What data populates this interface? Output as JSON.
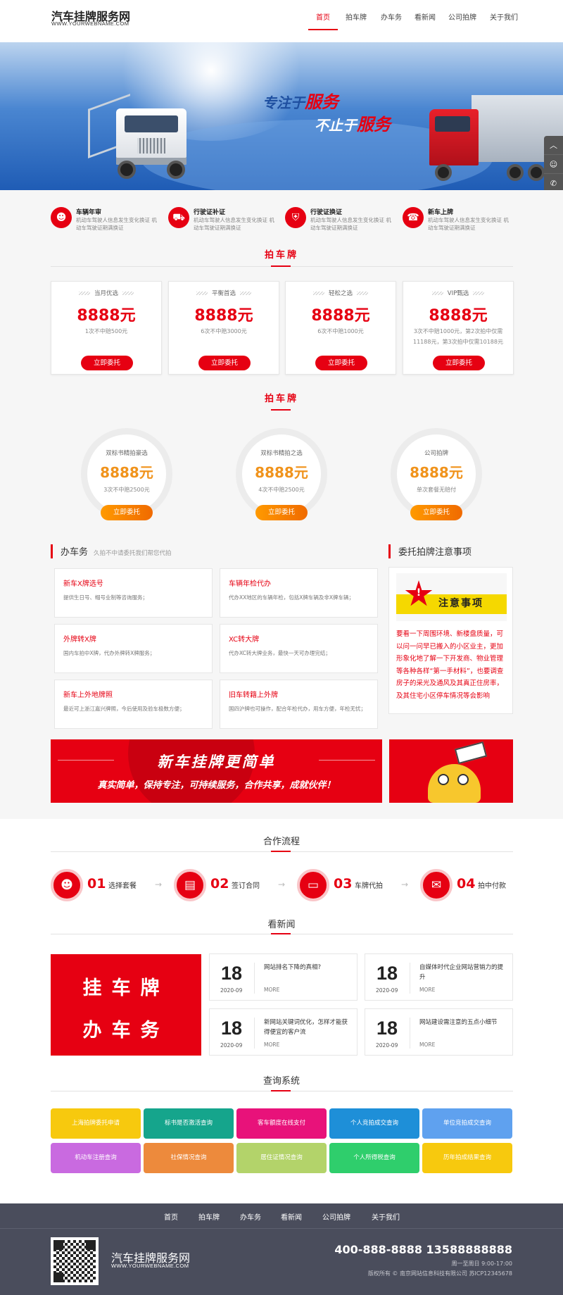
{
  "header": {
    "logo_title": "汽车挂牌服务网",
    "logo_sub": "WWW.YOURWEBNAME.COM",
    "nav": [
      "首页",
      "拍车牌",
      "办车务",
      "看新闻",
      "公司拍牌",
      "关于我们"
    ],
    "active_nav": "首页"
  },
  "banner": {
    "line1_prefix": "专注于",
    "line1_highlight": "服务",
    "line2_prefix": "不止于",
    "line2_highlight": "服务",
    "slide_count": 3,
    "active_slide": 3
  },
  "services": [
    {
      "title": "车辆年审",
      "desc": "机动车驾驶人信息发生变化换证 机动车驾驶证期满换证"
    },
    {
      "title": "行驶证补证",
      "desc": "机动车驾驶人信息发生变化换证 机动车驾驶证期满换证"
    },
    {
      "title": "行驶证换证",
      "desc": "机动车驾驶人信息发生变化换证 机动车驾驶证期满换证"
    },
    {
      "title": "新车上牌",
      "desc": "机动车驾驶人信息发生变化换证 机动车驾驶证期满换证"
    }
  ],
  "plates_title": "拍车牌",
  "plans": [
    {
      "label": "当月优选",
      "price": "8888元",
      "desc": "1次不中赔500元",
      "button": "立即委托"
    },
    {
      "label": "平衡首选",
      "price": "8888元",
      "desc": "6次不中赔3000元",
      "button": "立即委托"
    },
    {
      "label": "轻松之选",
      "price": "8888元",
      "desc": "6次不中赔1000元",
      "button": "立即委托"
    },
    {
      "label": "VIP甄选",
      "price": "8888元",
      "desc": "3次不中赔1000元，第2次拍中仅需11188元，第3次拍中仅需10188元",
      "button": "立即委托"
    }
  ],
  "plates_title2": "拍车牌",
  "circle_plans": [
    {
      "label": "双标书精拍豪选",
      "price": "8888元",
      "desc": "3次不中赔2500元",
      "button": "立即委托"
    },
    {
      "label": "双标书精拍之选",
      "price": "8888元",
      "desc": "4次不中赔2500元",
      "button": "立即委托"
    },
    {
      "label": "公司拍牌",
      "price": "8888元",
      "desc": "单次套餐无赔付",
      "button": "立即委托"
    }
  ],
  "business": {
    "title": "办车务",
    "subtitle": "久拍不中请委托我们帮您代拍",
    "items": [
      {
        "title": "新车X牌选号",
        "desc": "提供生日号、帽号业制等咨询服务；"
      },
      {
        "title": "车辆年检代办",
        "desc": "代办XX地区的车辆年检，包括X牌车辆及非X牌车辆；"
      },
      {
        "title": "外牌转X牌",
        "desc": "国内车拍中X牌，代办外牌转X牌服务；"
      },
      {
        "title": "XC转大牌",
        "desc": "代办XC转大牌业务，最快一天可办理完结；"
      },
      {
        "title": "新车上外地牌照",
        "desc": "最近可上浙江嘉兴牌照，今后使用及验车极数方便；"
      },
      {
        "title": "旧车转籍上外牌",
        "desc": "国四沪牌也可操作，配合年检代办，用车方便，年检无忧；"
      }
    ]
  },
  "notice": {
    "title": "委托拍牌注意事项",
    "image_text": "注意事项",
    "image_mark": "!",
    "text": "要看一下周围环境、新楼盘质量，可以问一问早已搬入的小区业主，更加形象化地了解一下开发商、物业管理等各种各样“第一手材料”，也要调查房子的采光及通风及其真正住房率，及其住宅小区停车情况等会影响"
  },
  "promo": {
    "title": "新车挂牌更简单",
    "subtitle": "真实简单，保持专注，可持续服务，合作共享，成就伙伴！"
  },
  "process": {
    "title": "合作流程",
    "steps": [
      {
        "num": "01",
        "label": "选择套餐"
      },
      {
        "num": "02",
        "label": "签订合同"
      },
      {
        "num": "03",
        "label": "车牌代拍"
      },
      {
        "num": "04",
        "label": "拍中付款"
      }
    ]
  },
  "news": {
    "title": "看新闻",
    "big_line1": "挂车牌",
    "big_line2": "办车务",
    "items": [
      {
        "day": "18",
        "ym": "2020-09",
        "title": "网站排名下降的真相?",
        "more": "MORE"
      },
      {
        "day": "18",
        "ym": "2020-09",
        "title": "自媒体时代企业网站营销力的提升",
        "more": "MORE"
      },
      {
        "day": "18",
        "ym": "2020-09",
        "title": "新网站关键词优化，怎样才能获得便宜的客户流",
        "more": "MORE"
      },
      {
        "day": "18",
        "ym": "2020-09",
        "title": "网站建设需注意的五点小细节",
        "more": "MORE"
      }
    ]
  },
  "query": {
    "title": "查询系统",
    "items": [
      {
        "label": "上海拍牌委托申请",
        "color": "#f7c90e"
      },
      {
        "label": "标书是否激活查询",
        "color": "#15a58c"
      },
      {
        "label": "客车额度在线支付",
        "color": "#e8127a"
      },
      {
        "label": "个人竞拍成交查询",
        "color": "#1e8fd8"
      },
      {
        "label": "单位竞拍成交查询",
        "color": "#5fa1ef"
      },
      {
        "label": "机动车注册查询",
        "color": "#c96ae0"
      },
      {
        "label": "社保情况查询",
        "color": "#ed8a3c"
      },
      {
        "label": "居住证情况查询",
        "color": "#b3d36a"
      },
      {
        "label": "个人所得税查询",
        "color": "#2fce6c"
      },
      {
        "label": "历年拍成结果查询",
        "color": "#f7c90e"
      }
    ]
  },
  "footer": {
    "nav": [
      "首页",
      "拍车牌",
      "办车务",
      "看新闻",
      "公司拍牌",
      "关于我们"
    ],
    "logo_title": "汽车挂牌服务网",
    "logo_sub": "WWW.YOURWEBNAME.COM",
    "phone": "400-888-8888  13588888888",
    "hours": "周一至周日 9:00-17:00",
    "copyright": "版权所有 © 南京网站信息科技有限公司 苏ICP12345678"
  },
  "colors": {
    "brand_red": "#e60012",
    "orange": "#f0931c",
    "footer_bg": "#4a4d5c"
  }
}
